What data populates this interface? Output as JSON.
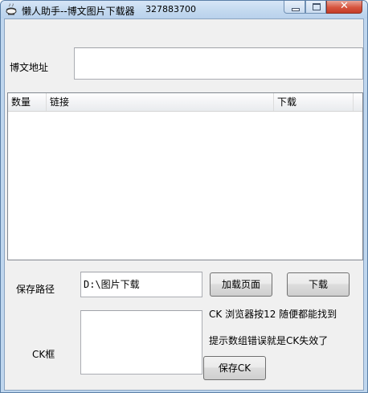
{
  "window": {
    "title": "懒人助手--博文图片下载器",
    "qq": "327883700",
    "minimize_symbol": "",
    "maximize_symbol": "",
    "close_symbol": "✕"
  },
  "form": {
    "url_label": "博文地址",
    "url_value": "",
    "save_path_label": "保存路径",
    "save_path_value": "D:\\图片下载",
    "ck_label": "CK框",
    "ck_value": ""
  },
  "list": {
    "columns": [
      "数量",
      "链接",
      "下载",
      ""
    ],
    "rows": []
  },
  "buttons": {
    "load_page": "加载页面",
    "download": "下载",
    "save_ck": "保存CK"
  },
  "hints": {
    "line1": "CK 浏览器按12 随便都能找到",
    "line2": "提示数组错误就是CK失效了"
  },
  "icons": {
    "app": "teacup-icon",
    "minimize": "minimize-icon",
    "maximize": "maximize-icon",
    "close": "close-icon"
  }
}
